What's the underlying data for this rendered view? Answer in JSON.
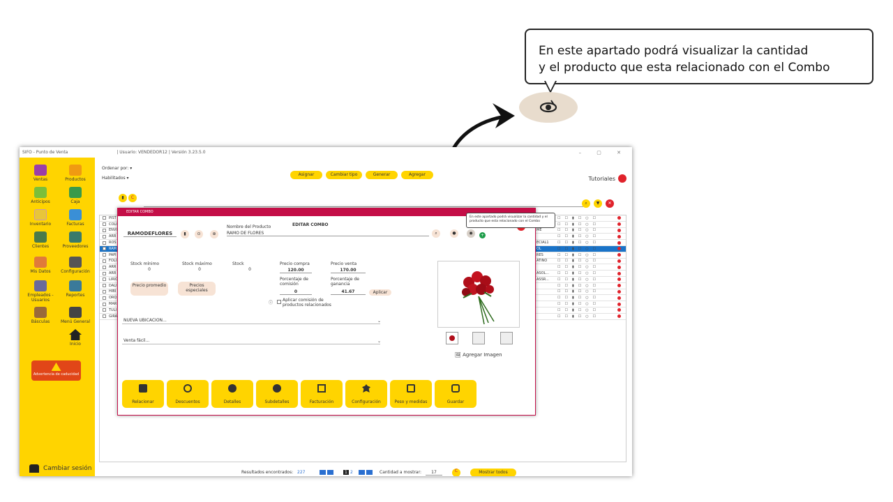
{
  "callout": {
    "line1": "En este apartado podrá visualizar la cantidad",
    "line2": "y el producto que esta relacionado con el Combo"
  },
  "app": {
    "title": "SIFO - Punto de Venta",
    "user_info": "| Usuario: VENDEDOR12 | Versión 3.23.5.0",
    "window_controls": "–  ▢  ✕"
  },
  "sidebar": {
    "items": [
      {
        "label": "Ventas",
        "color": "#9b3fa8"
      },
      {
        "label": "Productos",
        "color": "#f09a12"
      },
      {
        "label": "Anticipos",
        "color": "#7bbf3a"
      },
      {
        "label": "Caja",
        "color": "#3a9a4a"
      },
      {
        "label": "Inventario",
        "color": "#e8c53a"
      },
      {
        "label": "Facturas",
        "color": "#3a8fd6"
      },
      {
        "label": "Clientes",
        "color": "#4a7a4a"
      },
      {
        "label": "Proveedores",
        "color": "#3a7a6a"
      },
      {
        "label": "Mis Datos",
        "color": "#e07a3a"
      },
      {
        "label": "Configuración",
        "color": "#555555"
      },
      {
        "label": "Empleados - Usuarios",
        "color": "#6a6a9a"
      },
      {
        "label": "Reportes",
        "color": "#3a7a9a"
      },
      {
        "label": "Básculas",
        "color": "#9a6a3a"
      },
      {
        "label": "Menú General",
        "color": "#444444"
      },
      {
        "label": "Inicio",
        "color": "#222222"
      }
    ],
    "warning": "Advertencia de caducidad",
    "change_session": "Cambiar sesión"
  },
  "toolbar": {
    "order_by_label": "Ordenar por:",
    "filter_value": "Habilitados",
    "buttons": [
      "Asignar",
      "Cambiar tipo",
      "Generar",
      "Agregar"
    ],
    "tutorials": "Tutoriales"
  },
  "grid_rows": [
    "PIST",
    "COLI",
    "ENVI",
    "ARR",
    "ROS",
    "RAM",
    "PAPI",
    "FOLI",
    "ARR",
    "ARR",
    "LIRIO",
    "DALI",
    "HIBI",
    "ORQ",
    "MAR",
    "TULI",
    "GIRA"
  ],
  "grid_right": [
    "",
    "",
    "ME",
    "",
    "ECIAL1",
    "OL",
    "RES",
    "ATINO",
    "",
    "ASOL...",
    "ASSR...",
    "",
    "",
    "",
    "",
    "",
    ""
  ],
  "footer": {
    "results_label": "Resultados encontrados:",
    "results_count": "227",
    "page_current": "1",
    "page_total": "2",
    "qty_label": "Cantidad a mostrar:",
    "qty_value": "17",
    "show_all": "Mostrar todos"
  },
  "modal": {
    "header": "EDITAR COMBO",
    "title": "EDITAR COMBO",
    "code": "RAMODEFLORES",
    "name_label": "Nombre del Producto",
    "name_value": "RAMO DE FLORES",
    "stock_min_label": "Stock mínimo",
    "stock_min": "0",
    "stock_max_label": "Stock máximo",
    "stock_max": "0",
    "stock_label": "Stock",
    "stock": "0",
    "buy_label": "Precio compra",
    "buy": "120.00",
    "sell_label": "Precio venta",
    "sell": "170.00",
    "commission_label": "Porcentaje de comisión",
    "commission": "0",
    "profit_label": "Porcentaje de ganancia",
    "profit": "41.67",
    "apply": "Aplicar",
    "avg_price": "Precio promedio",
    "special_prices": "Precios especiales",
    "apply_commission": "Aplicar comisión de productos relacionados",
    "location": "NUEVA UBICACION...",
    "sale": "Venta fácil...",
    "add_image": "Agregar Imagen",
    "tiles": [
      "Relacionar",
      "Descuentos",
      "Detalles",
      "Subdetalles",
      "Facturación",
      "Configuración",
      "Peso y medidas",
      "Guardar"
    ]
  },
  "tooltip": "En este apartado podrá visualizar la cantidad y el producto que esta relacionado con el Combo"
}
